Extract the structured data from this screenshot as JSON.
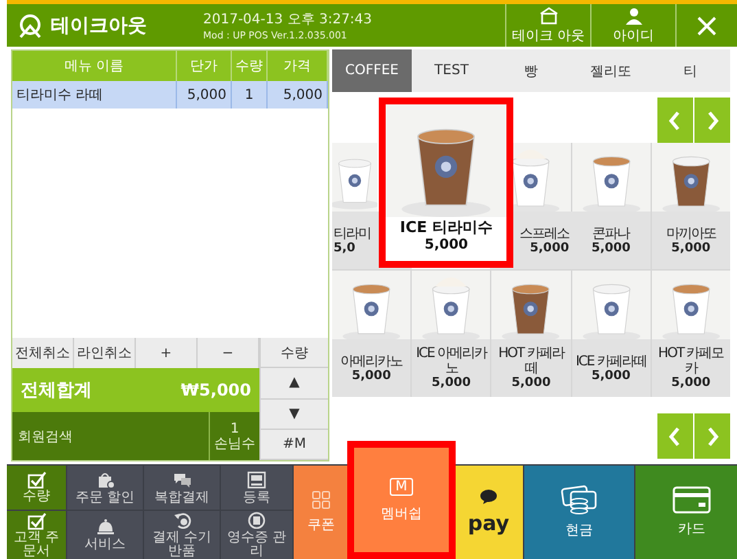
{
  "header": {
    "title": "테이크아웃",
    "datetime": "2017-04-13 오후 3:27:43",
    "version": "Mod : UP POS Ver.1.2.035.001",
    "buttons": [
      {
        "label": "테이크 아웃",
        "kind": "store"
      },
      {
        "label": "아이디",
        "kind": "user"
      }
    ]
  },
  "order_table": {
    "columns": [
      "메뉴 이름",
      "단가",
      "수량",
      "가격"
    ],
    "rows": [
      {
        "cells": [
          "티라미수 라떼",
          "5,000",
          "1",
          "5,000"
        ],
        "selected": true
      }
    ]
  },
  "order_buttons": [
    "전체취소",
    "라인취소",
    "+",
    "−"
  ],
  "side_buttons": [
    "수량",
    "▲",
    "▼",
    "#M"
  ],
  "total": {
    "label": "전체합계",
    "amount": "₩5,000"
  },
  "member_search": "회원검색",
  "guest": {
    "count": "1",
    "label": "손님수"
  },
  "categories": [
    {
      "label": "COFFEE",
      "selected": true
    },
    {
      "label": "TEST",
      "selected": false
    },
    {
      "label": "빵",
      "selected": false
    },
    {
      "label": "젤리또",
      "selected": false
    },
    {
      "label": "티",
      "selected": false
    }
  ],
  "products": [
    {
      "kind": "tile",
      "name": "티라미",
      "price": "5,0"
    },
    {
      "kind": "enlarged",
      "name": "ICE 티라미수",
      "price": "5,000",
      "highlighted": true
    },
    {
      "kind": "tile",
      "name": "스프레소",
      "price": "5,000"
    },
    {
      "kind": "tile",
      "name": "콘파나",
      "price": "5,000"
    },
    {
      "kind": "tile",
      "name": "마끼아또",
      "price": "5,000"
    },
    {
      "kind": "tile",
      "name": "아메리카노",
      "price": "5,000"
    },
    {
      "kind": "tile",
      "name": "ICE 아메리카노",
      "price": "5,000"
    },
    {
      "kind": "tile",
      "name": "HOT 카페라떼",
      "price": "5,000"
    },
    {
      "kind": "tile",
      "name": "ICE 카페라떼",
      "price": "5,000"
    },
    {
      "kind": "tile",
      "name": "HOT 카페모카",
      "price": "5,000"
    }
  ],
  "toggles": [
    {
      "label": "수량",
      "checked": true
    },
    {
      "label": "고객 주문서",
      "checked": true
    }
  ],
  "functions": [
    {
      "label": "주문 할인",
      "kind": "discount"
    },
    {
      "label": "복합결제",
      "kind": "chat"
    },
    {
      "label": "등록",
      "kind": "register"
    },
    {
      "label": "서비스",
      "kind": "bell"
    },
    {
      "label": "결제 수기 반품",
      "kind": "refund"
    },
    {
      "label": "영수증 관리",
      "kind": "receipt"
    }
  ],
  "payments": [
    {
      "kind": "coupon",
      "label": "쿠폰"
    },
    {
      "kind": "membership",
      "label": "멤버쉽",
      "icon_text": "M",
      "highlighted": true
    },
    {
      "kind": "kakaopay",
      "label": "pay"
    },
    {
      "kind": "cash",
      "label": "현금"
    },
    {
      "kind": "card",
      "label": "카드"
    }
  ]
}
